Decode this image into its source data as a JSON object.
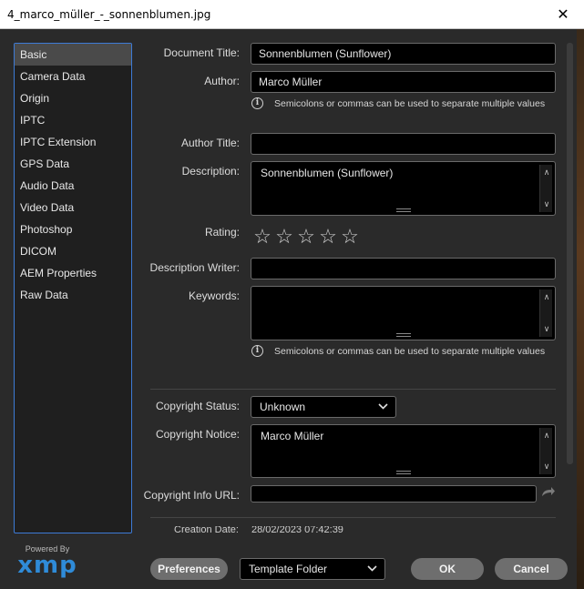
{
  "window": {
    "title": "4_marco_müller_-_sonnenblumen.jpg",
    "close_glyph": "✕"
  },
  "categories": [
    "Basic",
    "Camera Data",
    "Origin",
    "IPTC",
    "IPTC Extension",
    "GPS Data",
    "Audio Data",
    "Video Data",
    "Photoshop",
    "DICOM",
    "AEM Properties",
    "Raw Data"
  ],
  "selected_category": "Basic",
  "logo": {
    "powered": "Powered By",
    "name": "xmp"
  },
  "form": {
    "document_title": {
      "label": "Document Title:",
      "value": "Sonnenblumen (Sunflower)"
    },
    "author": {
      "label": "Author:",
      "value": "Marco Müller"
    },
    "hint": "Semicolons or commas can be used to separate multiple values",
    "author_title": {
      "label": "Author Title:",
      "value": ""
    },
    "description": {
      "label": "Description:",
      "value": "Sonnenblumen (Sunflower)"
    },
    "rating": {
      "label": "Rating:",
      "stars": 5,
      "filled": 0
    },
    "description_writer": {
      "label": "Description Writer:",
      "value": ""
    },
    "keywords": {
      "label": "Keywords:",
      "value": ""
    },
    "copyright_status": {
      "label": "Copyright Status:",
      "value": "Unknown"
    },
    "copyright_notice": {
      "label": "Copyright Notice:",
      "value": "Marco Müller"
    },
    "copyright_info_url": {
      "label": "Copyright Info URL:",
      "value": ""
    },
    "creation_date": {
      "label": "Creation Date:",
      "value": "28/02/2023 07:42:39"
    }
  },
  "buttons": {
    "preferences": "Preferences",
    "template_folder": "Template Folder",
    "ok": "OK",
    "cancel": "Cancel"
  },
  "colors": {
    "accent": "#3d7bd6",
    "logo": "#2f8bd8",
    "button": "#6e6e6e"
  }
}
